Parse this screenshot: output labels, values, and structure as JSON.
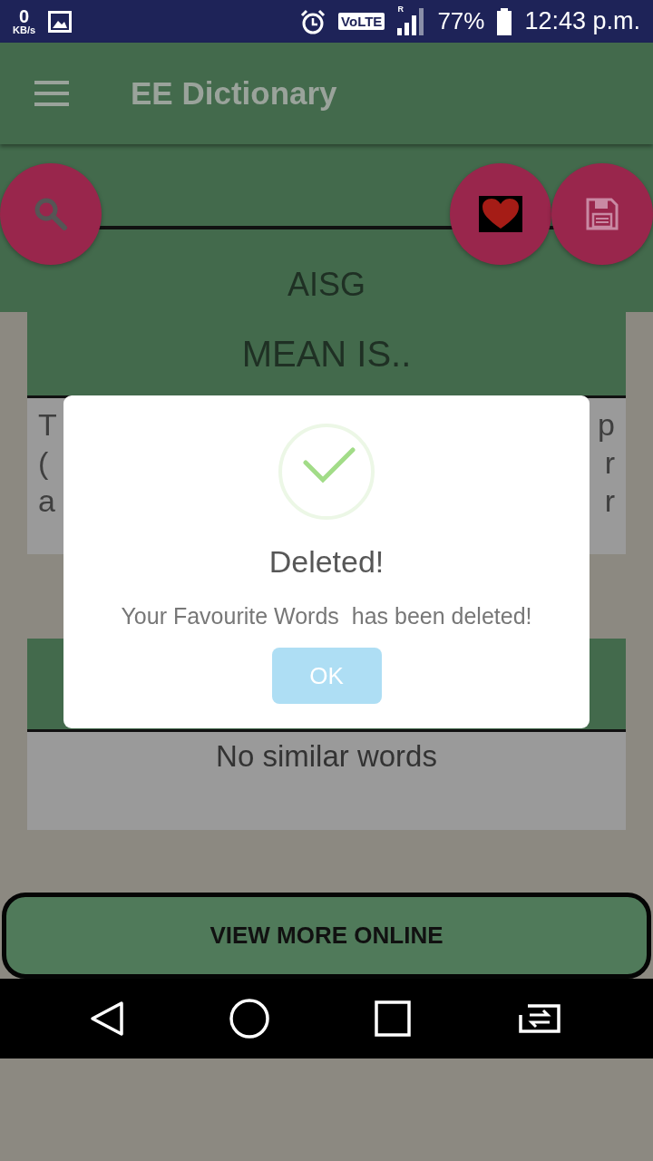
{
  "status_bar": {
    "speed": "0",
    "speed_unit": "KB/s",
    "network_badge": "VoLTE",
    "roaming": "R",
    "battery": "77%",
    "time": "12:43 p.m."
  },
  "app_bar": {
    "title": "EE Dictionary"
  },
  "word": "AISG",
  "meaning_heading": "MEAN IS..",
  "definition_lines": [
    {
      "left": "T",
      "right": "p"
    },
    {
      "left": "(",
      "right": "r"
    },
    {
      "left": "a",
      "right": "r"
    }
  ],
  "similar_words": "No similar words",
  "view_more_button": "VIEW MORE ONLINE",
  "dialog": {
    "title": "Deleted!",
    "message": "Your Favourite Words  has been deleted!",
    "button": "OK"
  }
}
